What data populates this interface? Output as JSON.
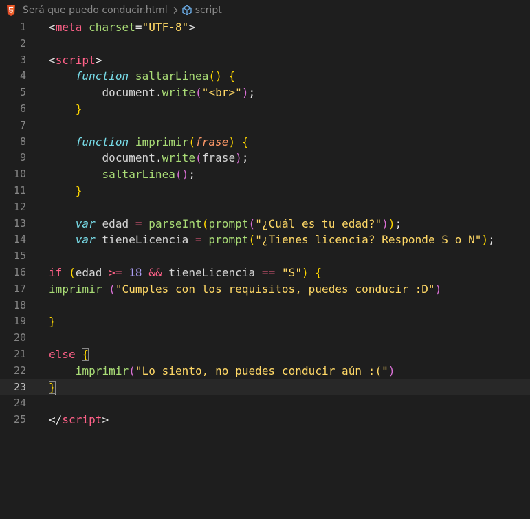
{
  "breadcrumb": {
    "file_icon": "html5-icon",
    "file_name": "Será que puedo conducir.html",
    "separator": "›",
    "symbol_icon": "cube-icon",
    "symbol_name": "script"
  },
  "editor": {
    "current_line": 23,
    "lines": [
      {
        "num": "1",
        "tokens": [
          [
            "t-punct",
            "<"
          ],
          [
            "t-tag",
            "meta"
          ],
          [
            "t-plain",
            " "
          ],
          [
            "t-attr",
            "charset"
          ],
          [
            "t-punct",
            "="
          ],
          [
            "t-string",
            "\"UTF-8\""
          ],
          [
            "t-punct",
            ">"
          ]
        ]
      },
      {
        "num": "2",
        "tokens": []
      },
      {
        "num": "3",
        "tokens": [
          [
            "t-punct",
            "<"
          ],
          [
            "t-tag",
            "script"
          ],
          [
            "t-punct",
            ">"
          ]
        ]
      },
      {
        "num": "4",
        "tokens": [
          [
            "t-plain",
            "    "
          ],
          [
            "t-storage",
            "function"
          ],
          [
            "t-plain",
            " "
          ],
          [
            "t-func",
            "saltarLinea"
          ],
          [
            "t-brace",
            "()"
          ],
          [
            "t-plain",
            " "
          ],
          [
            "t-brace",
            "{"
          ]
        ]
      },
      {
        "num": "5",
        "tokens": [
          [
            "t-plain",
            "        document"
          ],
          [
            "t-punct",
            "."
          ],
          [
            "t-method",
            "write"
          ],
          [
            "t-brace2",
            "("
          ],
          [
            "t-string",
            "\"<br>\""
          ],
          [
            "t-brace2",
            ")"
          ],
          [
            "t-punct",
            ";"
          ]
        ]
      },
      {
        "num": "6",
        "tokens": [
          [
            "t-plain",
            "    "
          ],
          [
            "t-brace",
            "}"
          ]
        ]
      },
      {
        "num": "7",
        "tokens": []
      },
      {
        "num": "8",
        "tokens": [
          [
            "t-plain",
            "    "
          ],
          [
            "t-storage",
            "function"
          ],
          [
            "t-plain",
            " "
          ],
          [
            "t-func",
            "imprimir"
          ],
          [
            "t-brace",
            "("
          ],
          [
            "t-param",
            "frase"
          ],
          [
            "t-brace",
            ")"
          ],
          [
            "t-plain",
            " "
          ],
          [
            "t-brace",
            "{"
          ]
        ]
      },
      {
        "num": "9",
        "tokens": [
          [
            "t-plain",
            "        document"
          ],
          [
            "t-punct",
            "."
          ],
          [
            "t-method",
            "write"
          ],
          [
            "t-brace2",
            "("
          ],
          [
            "t-plain",
            "frase"
          ],
          [
            "t-brace2",
            ")"
          ],
          [
            "t-punct",
            ";"
          ]
        ]
      },
      {
        "num": "10",
        "tokens": [
          [
            "t-plain",
            "        "
          ],
          [
            "t-method",
            "saltarLinea"
          ],
          [
            "t-brace2",
            "()"
          ],
          [
            "t-punct",
            ";"
          ]
        ]
      },
      {
        "num": "11",
        "tokens": [
          [
            "t-plain",
            "    "
          ],
          [
            "t-brace",
            "}"
          ]
        ]
      },
      {
        "num": "12",
        "tokens": []
      },
      {
        "num": "13",
        "tokens": [
          [
            "t-plain",
            "    "
          ],
          [
            "t-storage",
            "var"
          ],
          [
            "t-plain",
            " edad "
          ],
          [
            "t-op",
            "="
          ],
          [
            "t-plain",
            " "
          ],
          [
            "t-method",
            "parseInt"
          ],
          [
            "t-brace",
            "("
          ],
          [
            "t-method",
            "prompt"
          ],
          [
            "t-brace2",
            "("
          ],
          [
            "t-string",
            "\"¿Cuál es tu edad?\""
          ],
          [
            "t-brace2",
            ")"
          ],
          [
            "t-brace",
            ")"
          ],
          [
            "t-punct",
            ";"
          ]
        ]
      },
      {
        "num": "14",
        "tokens": [
          [
            "t-plain",
            "    "
          ],
          [
            "t-storage",
            "var"
          ],
          [
            "t-plain",
            " tieneLicencia "
          ],
          [
            "t-op",
            "="
          ],
          [
            "t-plain",
            " "
          ],
          [
            "t-method",
            "prompt"
          ],
          [
            "t-brace",
            "("
          ],
          [
            "t-string",
            "\"¿Tienes licencia? Responde S o N\""
          ],
          [
            "t-brace",
            ")"
          ],
          [
            "t-punct",
            ";"
          ]
        ]
      },
      {
        "num": "15",
        "tokens": []
      },
      {
        "num": "16",
        "tokens": [
          [
            "t-keyword",
            "if"
          ],
          [
            "t-plain",
            " "
          ],
          [
            "t-brace",
            "("
          ],
          [
            "t-plain",
            "edad "
          ],
          [
            "t-op",
            ">="
          ],
          [
            "t-plain",
            " "
          ],
          [
            "t-number",
            "18"
          ],
          [
            "t-plain",
            " "
          ],
          [
            "t-op",
            "&&"
          ],
          [
            "t-plain",
            " tieneLicencia "
          ],
          [
            "t-op",
            "=="
          ],
          [
            "t-plain",
            " "
          ],
          [
            "t-string",
            "\"S\""
          ],
          [
            "t-brace",
            ")"
          ],
          [
            "t-plain",
            " "
          ],
          [
            "t-brace",
            "{"
          ]
        ]
      },
      {
        "num": "17",
        "tokens": [
          [
            "t-method",
            "imprimir"
          ],
          [
            "t-plain",
            " "
          ],
          [
            "t-brace2",
            "("
          ],
          [
            "t-string",
            "\"Cumples con los requisitos, puedes conducir :D\""
          ],
          [
            "t-brace2",
            ")"
          ]
        ]
      },
      {
        "num": "18",
        "tokens": []
      },
      {
        "num": "19",
        "tokens": [
          [
            "t-brace",
            "}"
          ]
        ]
      },
      {
        "num": "20",
        "tokens": []
      },
      {
        "num": "21",
        "tokens": [
          [
            "t-keyword",
            "else"
          ],
          [
            "t-plain",
            " "
          ],
          [
            "t-brace bracket-hl",
            "{"
          ]
        ]
      },
      {
        "num": "22",
        "tokens": [
          [
            "t-plain",
            "    "
          ],
          [
            "t-method",
            "imprimir"
          ],
          [
            "t-brace2",
            "("
          ],
          [
            "t-string",
            "\"Lo siento, no puedes conducir aún :(\""
          ],
          [
            "t-brace2",
            ")"
          ]
        ]
      },
      {
        "num": "23",
        "tokens": [
          [
            "t-brace bracket-hl",
            "}"
          ],
          [
            "cursor",
            ""
          ]
        ]
      },
      {
        "num": "24",
        "tokens": []
      },
      {
        "num": "25",
        "tokens": [
          [
            "t-punct",
            "</"
          ],
          [
            "t-tag",
            "script"
          ],
          [
            "t-punct",
            ">"
          ]
        ]
      }
    ]
  }
}
